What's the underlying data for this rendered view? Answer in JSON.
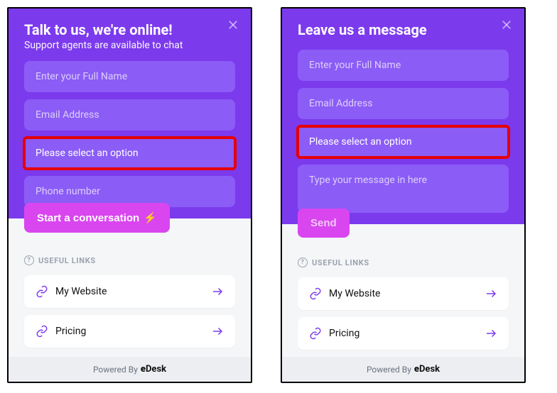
{
  "colors": {
    "primary": "#7c3aed",
    "accent": "#d946ef",
    "highlight": "#e60000"
  },
  "left": {
    "title": "Talk to us, we're online!",
    "subtitle": "Support agents are available to chat",
    "name_ph": "Enter your Full Name",
    "email_ph": "Email Address",
    "select_label": "Please select an option",
    "phone_ph": "Phone number",
    "cta": "Start a conversation",
    "cta_icon": "⚡"
  },
  "right": {
    "title": "Leave us a message",
    "name_ph": "Enter your Full Name",
    "email_ph": "Email Address",
    "select_label": "Please select an option",
    "message_ph": "Type your message in here",
    "cta": "Send"
  },
  "links": {
    "section": "USEFUL LINKS",
    "items": [
      {
        "label": "My Website"
      },
      {
        "label": "Pricing"
      }
    ]
  },
  "footer": {
    "powered": "Powered By",
    "brand": "eDesk"
  }
}
